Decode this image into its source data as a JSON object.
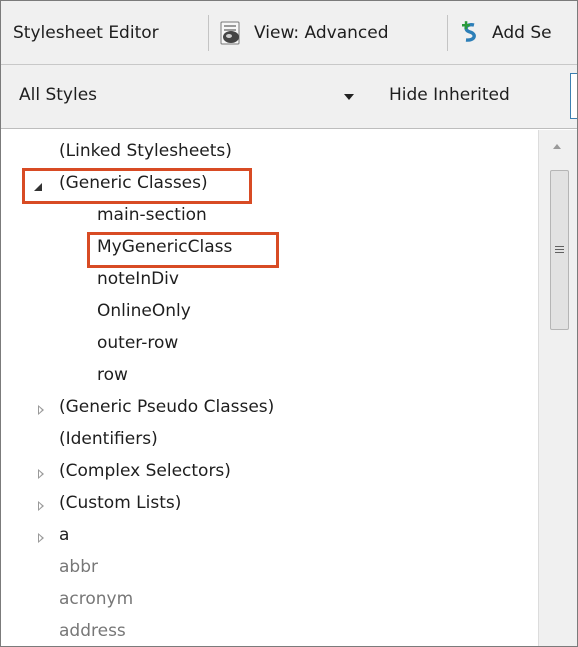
{
  "toolbar": {
    "title": "Stylesheet Editor",
    "view_label": "View: Advanced",
    "add_label": "Add Se"
  },
  "filter": {
    "dropdown_value": "All Styles",
    "hide_inherited_label": "Hide Inherited"
  },
  "tree": {
    "linked": "(Linked Stylesheets)",
    "generic_classes": "(Generic Classes)",
    "children": [
      "main-section",
      "MyGenericClass",
      "noteInDiv",
      "OnlineOnly",
      "outer-row",
      "row"
    ],
    "generic_pseudo": "(Generic Pseudo Classes)",
    "identifiers": "(Identifiers)",
    "complex": "(Complex Selectors)",
    "custom_lists": "(Custom Lists)",
    "a": "a",
    "abbr": "abbr",
    "acronym": "acronym",
    "address": "address"
  },
  "colors": {
    "highlight": "#d84b24",
    "add_icon": "#2a9a3a"
  },
  "icons": {
    "view": "paintbrush-icon",
    "add": "add-style-icon",
    "dropdown": "dropdown-arrow-icon",
    "expanded": "expanded-triangle-icon",
    "collapsed": "collapsed-triangle-icon"
  }
}
